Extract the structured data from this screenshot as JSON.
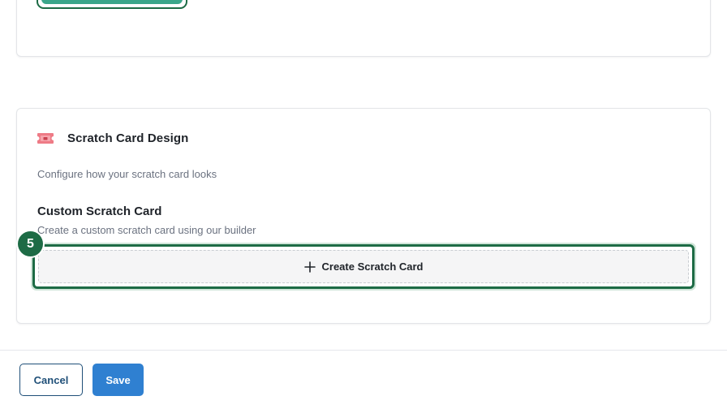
{
  "scratch_card_section": {
    "title": "Scratch Card Design",
    "description": "Configure how your scratch card looks",
    "icon": "ticket-icon",
    "custom": {
      "title": "Custom Scratch Card",
      "description": "Create a custom scratch card using our builder",
      "create_button_label": "Create Scratch Card",
      "create_button_icon": "plus-icon"
    }
  },
  "step_badge": "5",
  "footer": {
    "cancel_label": "Cancel",
    "save_label": "Save"
  },
  "colors": {
    "highlight_green": "#1d6b45",
    "top_button_fill": "#3aa68a",
    "ticket_pink": "#ee7b86",
    "save_blue": "#2f80d1",
    "cancel_navy": "#1f4f78"
  }
}
